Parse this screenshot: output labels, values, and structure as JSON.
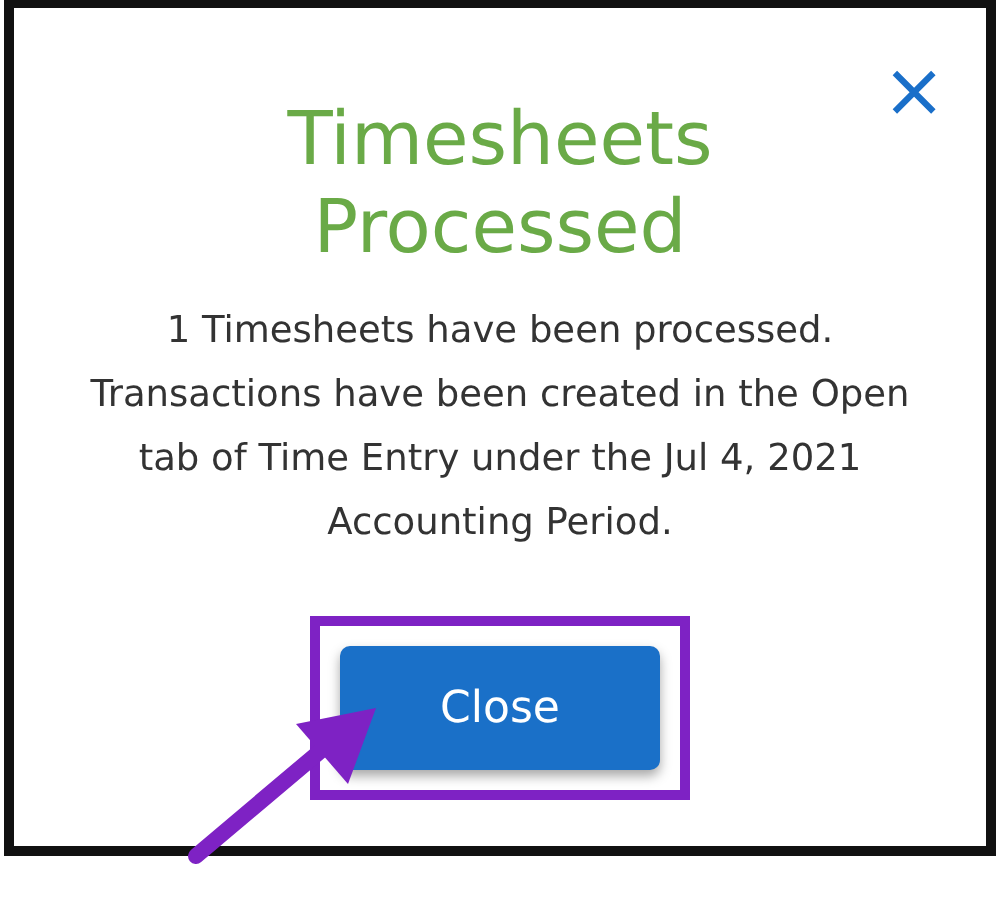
{
  "dialog": {
    "title": "Timesheets Processed",
    "close_icon": "×",
    "message": "1 Timesheets have been processed. Transactions have been created in the Open tab of Time Entry under the Jul 4, 2021  Accounting Period.",
    "buttons": [
      {
        "label": "Close",
        "highlighted": true
      }
    ]
  }
}
